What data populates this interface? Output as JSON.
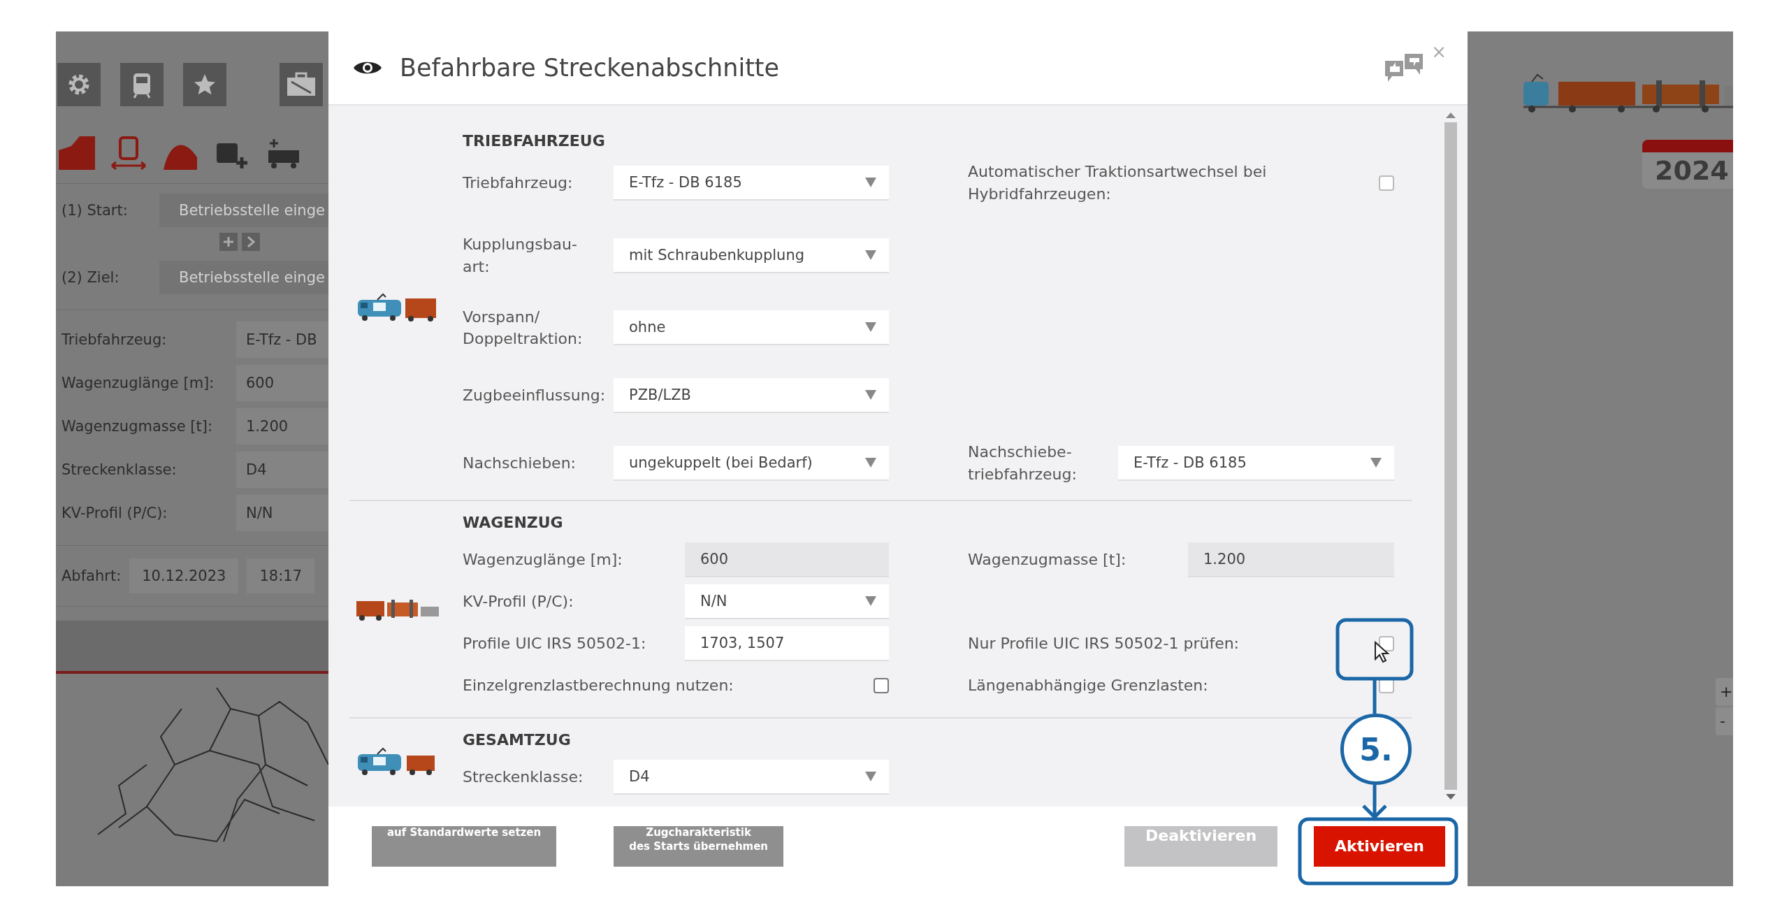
{
  "background": {
    "route": [
      {
        "label": "(1) Start:",
        "placeholder": "Betriebsstelle einge"
      },
      {
        "label": "(2) Ziel:",
        "placeholder": "Betriebsstelle einge"
      }
    ],
    "summary": [
      {
        "label": "Triebfahrzeug:",
        "value": "E-Tfz - DB"
      },
      {
        "label": "Wagenzuglänge [m]:",
        "value": "600"
      },
      {
        "label": "Wagenzugmasse [t]:",
        "value": "1.200"
      },
      {
        "label": "Streckenklasse:",
        "value": "D4"
      },
      {
        "label": "KV-Profil (P/C):",
        "value": "N/N"
      }
    ],
    "departure": {
      "label": "Abfahrt:",
      "date": "10.12.2023",
      "time": "18:17"
    },
    "calendar_year": "2024",
    "zoom_controls": [
      "+",
      "-"
    ]
  },
  "dialog": {
    "title": "Befahrbare Streckenabschnitte",
    "close": "×",
    "sections": [
      {
        "title": "TRIEBFAHRZEUG",
        "rows": [
          {
            "left": {
              "kind": "select",
              "label": "Triebfahrzeug:",
              "value": "E-Tfz - DB 6185"
            },
            "right": {
              "kind": "checkbox",
              "label": "Automatischer Traktionsartwechsel bei\nHybridfahrzeugen:",
              "checked": false
            }
          },
          {
            "left": {
              "kind": "select",
              "label": "Kupplungsbau-\nart:",
              "value": "mit Schraubenkupplung"
            }
          },
          {
            "left": {
              "kind": "select",
              "label": "Vorspann/\nDoppeltraktion:",
              "value": "ohne"
            }
          },
          {
            "left": {
              "kind": "select",
              "label": "Zugbeeinflussung:",
              "value": "PZB/LZB"
            }
          },
          {
            "left": {
              "kind": "select",
              "label": "Nachschieben:",
              "value": "ungekuppelt (bei Bedarf)"
            },
            "right": {
              "kind": "select",
              "label": "Nachschiebe-\ntriebfahrzeug:",
              "value": "E-Tfz - DB 6185"
            }
          }
        ]
      },
      {
        "title": "WAGENZUG",
        "rows": [
          {
            "left": {
              "kind": "readonly",
              "label": "Wagenzuglänge [m]:",
              "value": "600"
            },
            "right": {
              "kind": "readonly",
              "label": "Wagenzugmasse [t]:",
              "value": "1.200"
            }
          },
          {
            "left": {
              "kind": "select",
              "label": "KV-Profil (P/C):",
              "value": "N/N"
            }
          },
          {
            "left": {
              "kind": "text",
              "label": "Profile UIC IRS 50502-1:",
              "value": "1703, 1507"
            },
            "right": {
              "kind": "checkbox",
              "label": "Nur Profile UIC IRS 50502-1 prüfen:",
              "checked": false
            }
          },
          {
            "left": {
              "kind": "checkbox",
              "label": "Einzelgrenzlastberechnung nutzen:",
              "checked": false
            },
            "right": {
              "kind": "checkbox",
              "label": "Längenabhängige Grenzlasten:",
              "checked": false
            }
          }
        ]
      },
      {
        "title": "GESAMTZUG",
        "rows": [
          {
            "left": {
              "kind": "select",
              "label": "Streckenklasse:",
              "value": "D4"
            }
          }
        ]
      }
    ],
    "footer_left": [
      {
        "label": "auf Standardwerte setzen",
        "kind": "secondary",
        "disabled": false
      },
      {
        "label": "Zugcharakteristik\ndes Starts übernehmen",
        "kind": "secondary",
        "disabled": false
      }
    ],
    "footer_right": [
      {
        "label": "Deaktivieren",
        "kind": "secondary",
        "disabled": true
      },
      {
        "label": "Aktivieren",
        "kind": "primary",
        "disabled": false
      }
    ]
  },
  "annotation": {
    "step": "5."
  }
}
